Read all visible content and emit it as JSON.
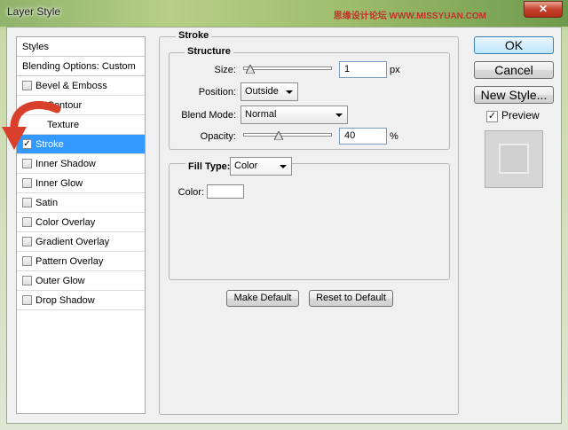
{
  "window": {
    "title": "Layer Style",
    "watermark": "思缘设计论坛 WWW.MISSYUAN.COM",
    "close_label": "✕"
  },
  "styles_list": {
    "header": "Styles",
    "blending_options": "Blending Options: Custom",
    "items": [
      {
        "label": "Bevel & Emboss",
        "checked": false,
        "sub": false
      },
      {
        "label": "Contour",
        "checked": false,
        "sub": true
      },
      {
        "label": "Texture",
        "checked": false,
        "sub": true
      },
      {
        "label": "Stroke",
        "checked": true,
        "sub": false,
        "selected": true
      },
      {
        "label": "Inner Shadow",
        "checked": false,
        "sub": false
      },
      {
        "label": "Inner Glow",
        "checked": false,
        "sub": false
      },
      {
        "label": "Satin",
        "checked": false,
        "sub": false
      },
      {
        "label": "Color Overlay",
        "checked": false,
        "sub": false
      },
      {
        "label": "Gradient Overlay",
        "checked": false,
        "sub": false
      },
      {
        "label": "Pattern Overlay",
        "checked": false,
        "sub": false
      },
      {
        "label": "Outer Glow",
        "checked": false,
        "sub": false
      },
      {
        "label": "Drop Shadow",
        "checked": false,
        "sub": false
      }
    ]
  },
  "stroke": {
    "group_title": "Stroke",
    "structure_title": "Structure",
    "size": {
      "label": "Size:",
      "value": "1",
      "unit": "px",
      "slider_fraction": 0.0
    },
    "position": {
      "label": "Position:",
      "value": "Outside"
    },
    "blend_mode": {
      "label": "Blend Mode:",
      "value": "Normal"
    },
    "opacity": {
      "label": "Opacity:",
      "value": "40",
      "unit": "%",
      "slider_fraction": 0.4
    },
    "fill_type": {
      "label": "Fill Type:",
      "value": "Color"
    },
    "color": {
      "label": "Color:",
      "swatch": "#ffffff"
    },
    "make_default_label": "Make Default",
    "reset_default_label": "Reset to Default"
  },
  "actions": {
    "ok_label": "OK",
    "cancel_label": "Cancel",
    "new_style_label": "New Style...",
    "preview_label": "Preview",
    "preview_checked": true
  },
  "colors": {
    "selection": "#3399ff",
    "arrow": "#d9402b"
  }
}
